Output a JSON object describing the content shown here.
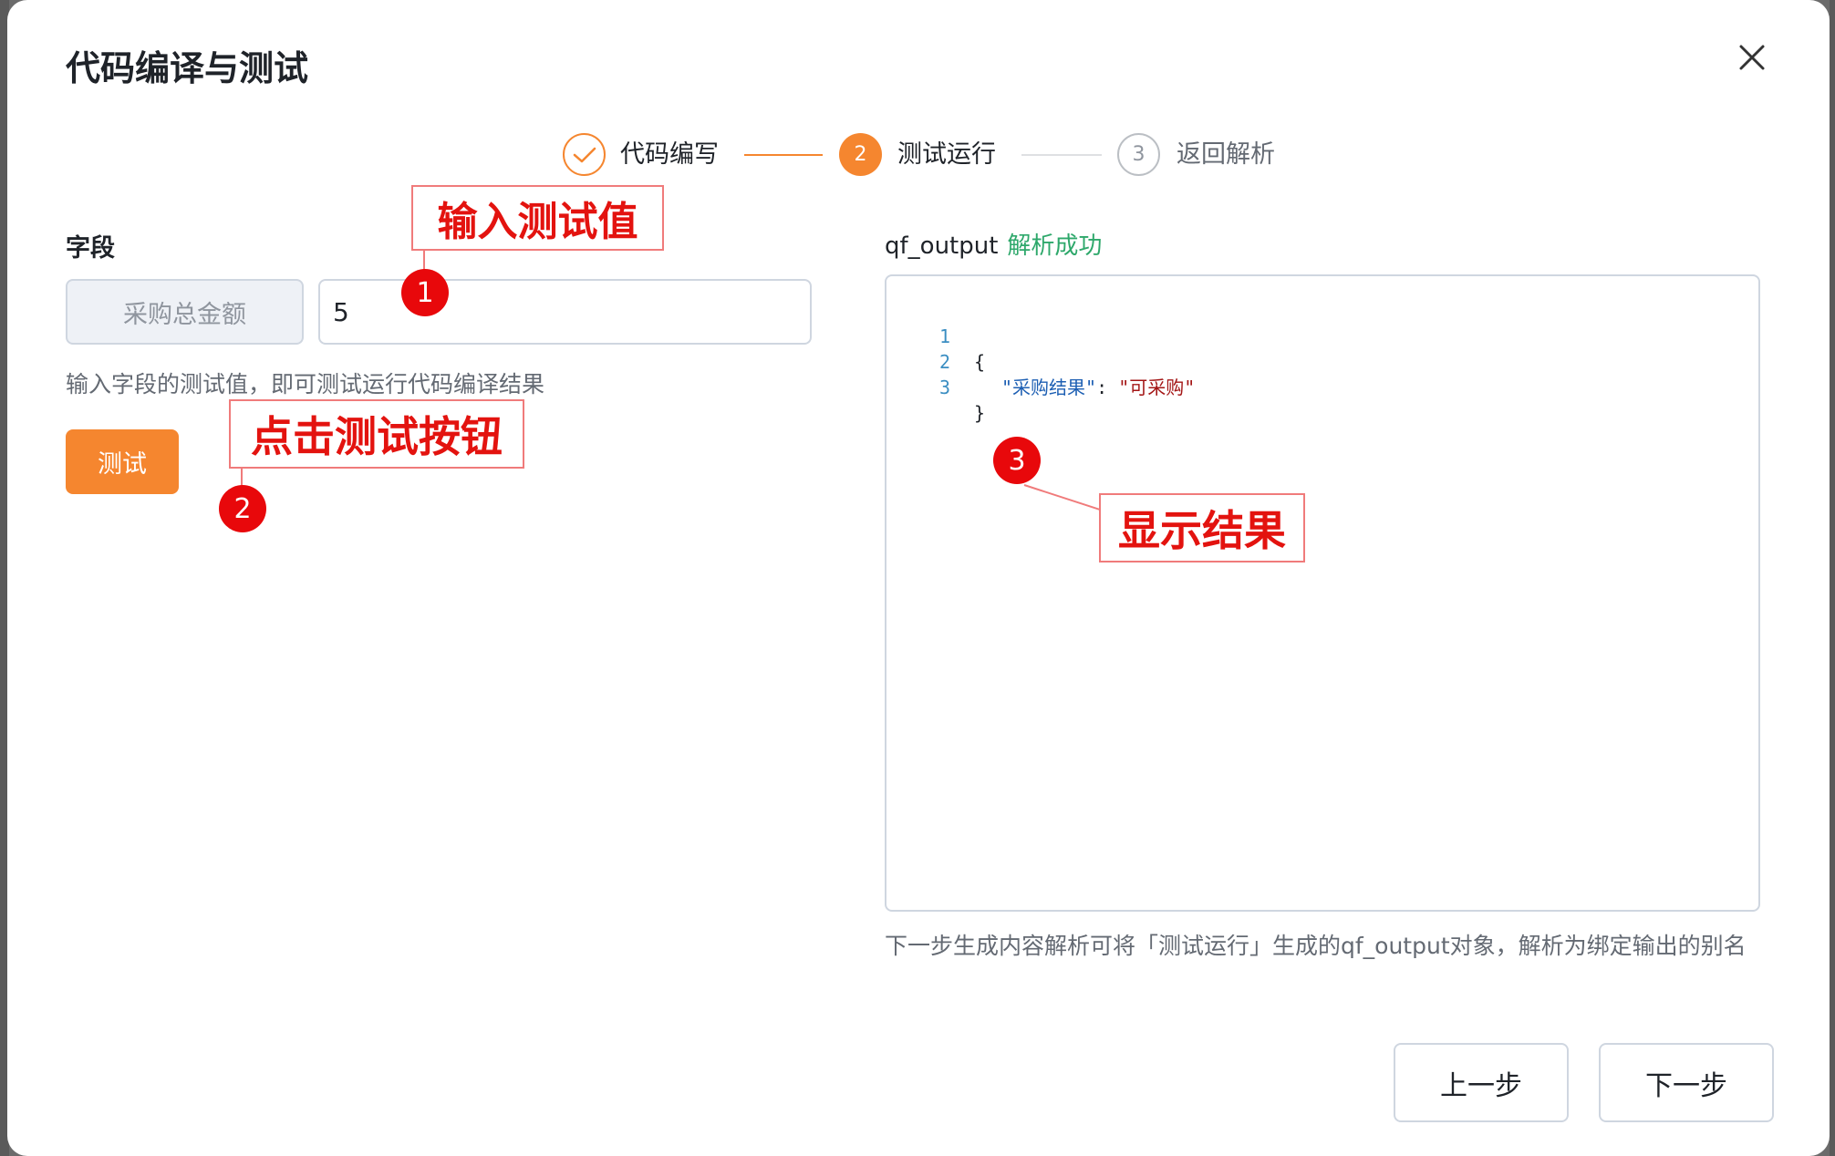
{
  "dialog": {
    "title": "代码编译与测试",
    "close_icon": "close-icon"
  },
  "steps": [
    {
      "label": "代码编写",
      "state": "done",
      "marker": ""
    },
    {
      "label": "测试运行",
      "state": "active",
      "marker": "2"
    },
    {
      "label": "返回解析",
      "state": "pending",
      "marker": "3"
    }
  ],
  "left": {
    "field_title": "字段",
    "field_name": "采购总金额",
    "field_value": "5",
    "hint": "输入字段的测试值，即可测试运行代码编译结果",
    "test_button": "测试"
  },
  "right": {
    "output_name": "qf_output",
    "output_status": "解析成功",
    "code_lines": [
      {
        "n": "1",
        "text": "{"
      },
      {
        "n": "2",
        "key": "\"采购结果\"",
        "sep": ": ",
        "value": "\"可采购\""
      },
      {
        "n": "3",
        "text": "}"
      }
    ],
    "footnote": "下一步生成内容解析可将「测试运行」生成的qf_output对象，解析为绑定输出的别名"
  },
  "footer": {
    "prev_button": "上一步",
    "next_button": "下一步"
  },
  "annotations": [
    {
      "badge": "1",
      "text": "输入测试值"
    },
    {
      "badge": "2",
      "text": "点击测试按钮"
    },
    {
      "badge": "3",
      "text": "显示结果"
    }
  ],
  "colors": {
    "accent": "#f5862f",
    "success": "#2ea86b",
    "annotation": "#e3130f"
  }
}
